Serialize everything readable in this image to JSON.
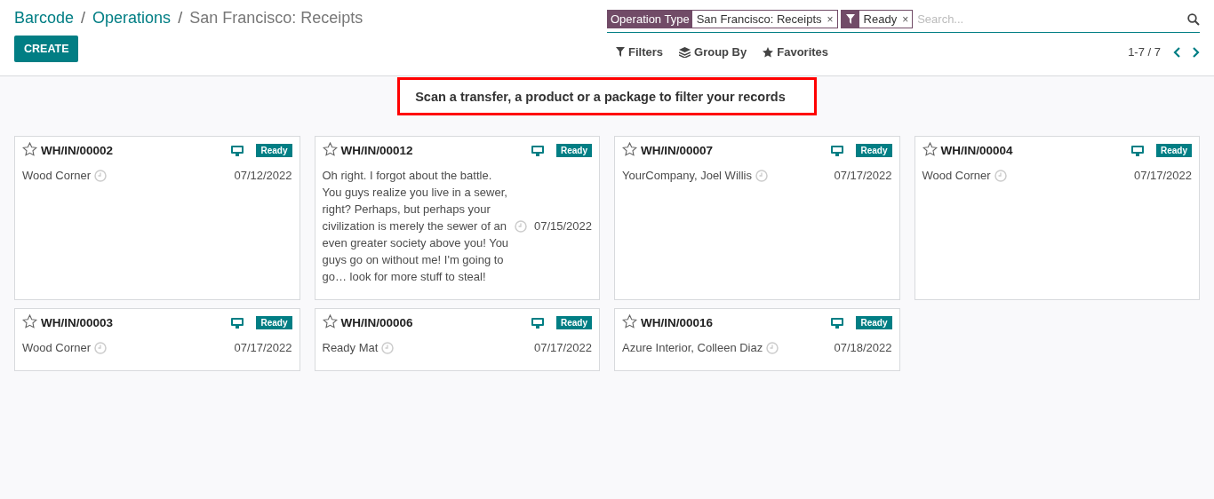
{
  "breadcrumbs": [
    {
      "label": "Barcode",
      "link": true
    },
    {
      "separator": "/",
      "label": "Operations",
      "link": true
    },
    {
      "separator": "/",
      "label": "San Francisco: Receipts",
      "link": false
    }
  ],
  "create_button": "CREATE",
  "search": {
    "facets": [
      {
        "kind": "field",
        "label": "Operation Type",
        "value": "San Francisco: Receipts",
        "remove": "×"
      },
      {
        "kind": "filter",
        "value": "Ready",
        "remove": "×"
      }
    ],
    "placeholder": "Search..."
  },
  "toolbar": [
    "Filters",
    "Group By",
    "Favorites"
  ],
  "pager": "1-7 / 7",
  "banner": "Scan a transfer, a product or a package to filter your records",
  "cards": [
    {
      "reference": "WH/IN/00002",
      "starred": false,
      "status": "Ready",
      "partner": "Wood Corner",
      "date": "07/12/2022"
    },
    {
      "reference": "WH/IN/00012",
      "starred": false,
      "status": "Ready",
      "partner": "Oh right. I forgot about the battle. You guys realize you live in a sewer, right? Perhaps, but perhaps your civilization is merely the sewer of an even greater society above you! You guys go on without me! I'm going to go… look for more stuff to steal!",
      "date": "07/15/2022"
    },
    {
      "reference": "WH/IN/00007",
      "starred": false,
      "status": "Ready",
      "partner": "YourCompany, Joel Willis",
      "date": "07/17/2022"
    },
    {
      "reference": "WH/IN/00004",
      "starred": false,
      "status": "Ready",
      "partner": "Wood Corner",
      "date": "07/17/2022"
    },
    {
      "reference": "WH/IN/00003",
      "starred": false,
      "status": "Ready",
      "partner": "Wood Corner",
      "date": "07/17/2022"
    },
    {
      "reference": "WH/IN/00006",
      "starred": false,
      "status": "Ready",
      "partner": "Ready Mat",
      "date": "07/17/2022"
    },
    {
      "reference": "WH/IN/00016",
      "starred": false,
      "status": "Ready",
      "partner": "Azure Interior, Colleen Diaz",
      "date": "07/18/2022"
    }
  ]
}
